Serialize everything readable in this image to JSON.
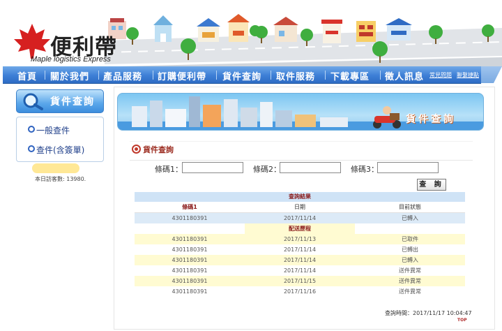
{
  "brand": {
    "name_cn": "便利帶",
    "name_en": "Maple logistics Express"
  },
  "nav": {
    "items": [
      "首頁",
      "關於我們",
      "產品服務",
      "訂購便利帶",
      "貨件查詢",
      "取件服務",
      "下載專區",
      "徵人訊息"
    ],
    "links": [
      "常見問題",
      "聯繫捷點"
    ]
  },
  "sidebar": {
    "header": "貨件查詢",
    "items": [
      "一般查件",
      "查件(含簽單)"
    ],
    "visitor_count": "本日訪客數: 13980."
  },
  "banner": {
    "title": "貨件查詢"
  },
  "section": {
    "title": "貨件查詢"
  },
  "search": {
    "labels": [
      "條碼1：",
      "條碼2：",
      "條碼3："
    ],
    "values": [
      "",
      "",
      ""
    ],
    "submit_label": "查 詢"
  },
  "results": {
    "title": "查詢結果",
    "columns": [
      "條碼1",
      "日期",
      "目前狀態"
    ],
    "current": {
      "barcode": "4301180391",
      "date": "2017/11/14",
      "status": "已轉入"
    },
    "history_title": "配送歷程",
    "history": [
      {
        "barcode": "4301180391",
        "date": "2017/11/13",
        "status": "已取件"
      },
      {
        "barcode": "4301180391",
        "date": "2017/11/14",
        "status": "已轉出"
      },
      {
        "barcode": "4301180391",
        "date": "2017/11/14",
        "status": "已轉入"
      },
      {
        "barcode": "4301180391",
        "date": "2017/11/14",
        "status": "送件異常"
      },
      {
        "barcode": "4301180391",
        "date": "2017/11/15",
        "status": "送件異常"
      },
      {
        "barcode": "4301180391",
        "date": "2017/11/16",
        "status": "送件異常"
      }
    ],
    "query_time": "查詢時間：2017/11/17 10:04:47"
  },
  "footer": {
    "top_label": "TOP"
  },
  "colors": {
    "nav_blue": "#3d7fd6",
    "title_red": "#9b2b1f",
    "table_blue": "#dceaf7",
    "table_yellow": "#fffbd2"
  },
  "icons": [
    "maple-leaf-logo",
    "magnifier-icon",
    "section-target-icon",
    "delivery-man-icon"
  ]
}
